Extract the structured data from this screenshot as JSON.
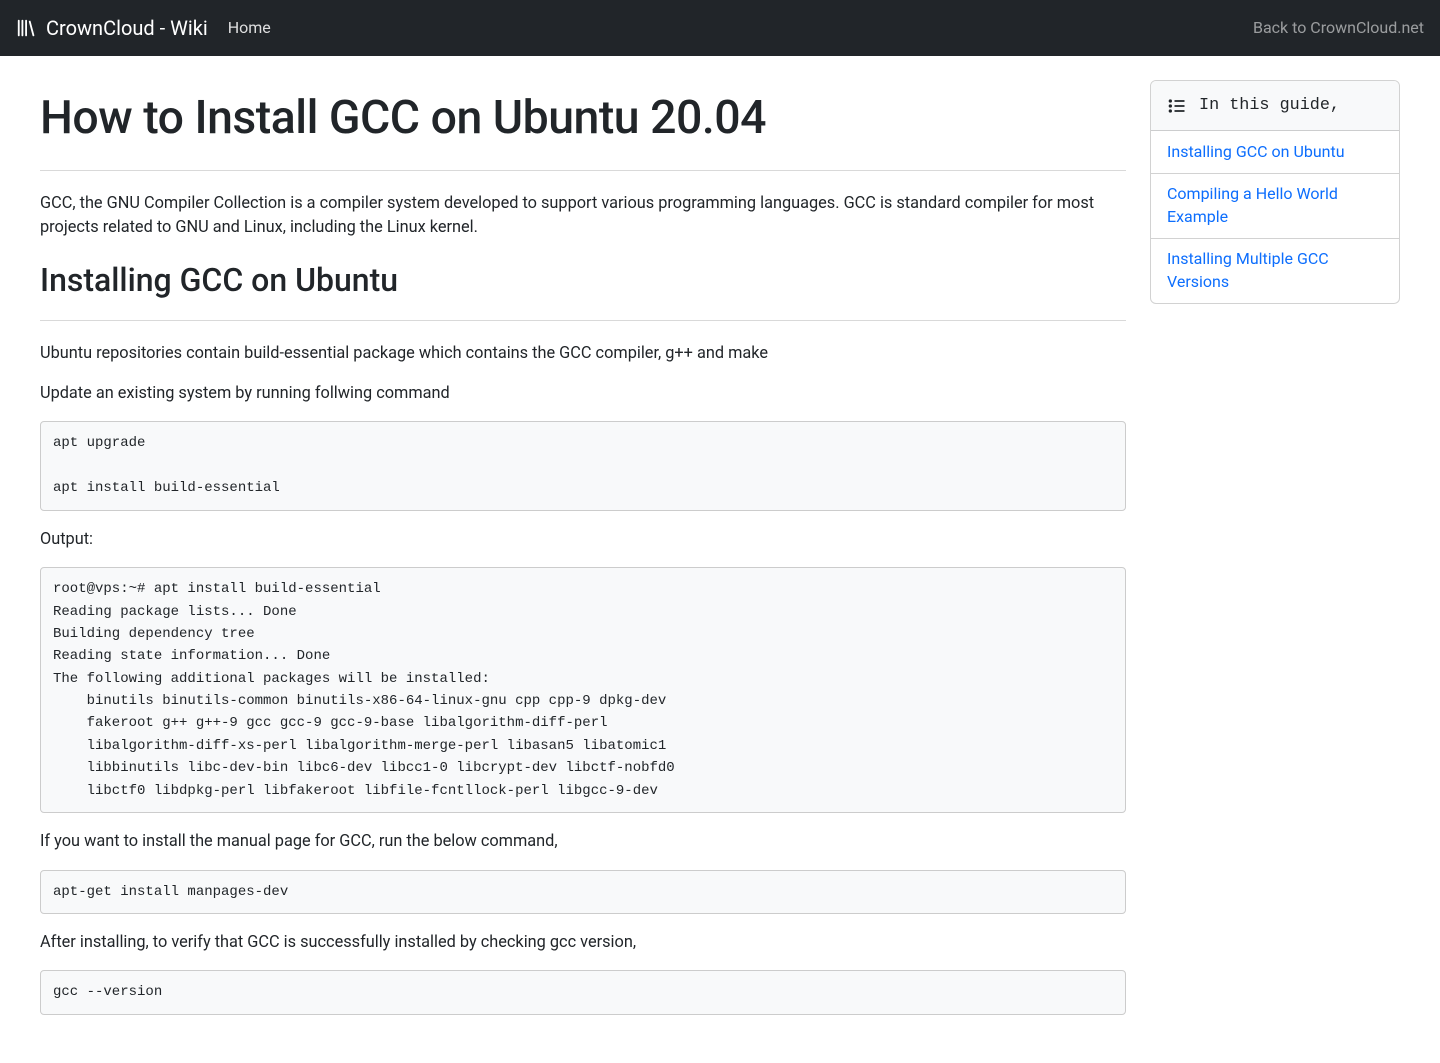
{
  "nav": {
    "brand": "CrownCloud - Wiki",
    "home": "Home",
    "back": "Back to CrownCloud.net"
  },
  "article": {
    "title": "How to Install GCC on Ubuntu 20.04",
    "intro": "GCC, the GNU Compiler Collection is a compiler system developed to support various programming languages. GCC is standard compiler for most projects related to GNU and Linux, including the Linux kernel.",
    "section1_heading": "Installing GCC on Ubuntu",
    "p1": "Ubuntu repositories contain build-essential package which contains the GCC compiler, g++ and make",
    "p2": "Update an existing system by running follwing command",
    "code1": "apt upgrade\n\napt install build-essential",
    "output_label": "Output:",
    "code2": "root@vps:~# apt install build-essential\nReading package lists... Done\nBuilding dependency tree\nReading state information... Done\nThe following additional packages will be installed:\n    binutils binutils-common binutils-x86-64-linux-gnu cpp cpp-9 dpkg-dev\n    fakeroot g++ g++-9 gcc gcc-9 gcc-9-base libalgorithm-diff-perl\n    libalgorithm-diff-xs-perl libalgorithm-merge-perl libasan5 libatomic1\n    libbinutils libc-dev-bin libc6-dev libcc1-0 libcrypt-dev libctf-nobfd0\n    libctf0 libdpkg-perl libfakeroot libfile-fcntllock-perl libgcc-9-dev",
    "p3": "If you want to install the manual page for GCC, run the below command,",
    "code3": "apt-get install manpages-dev",
    "p4": "After installing, to verify that GCC is successfully installed by checking gcc version,",
    "code4": "gcc --version"
  },
  "toc": {
    "header": "In this guide,",
    "items": [
      "Installing GCC on Ubuntu",
      "Compiling a Hello World Example",
      "Installing Multiple GCC Versions"
    ]
  }
}
